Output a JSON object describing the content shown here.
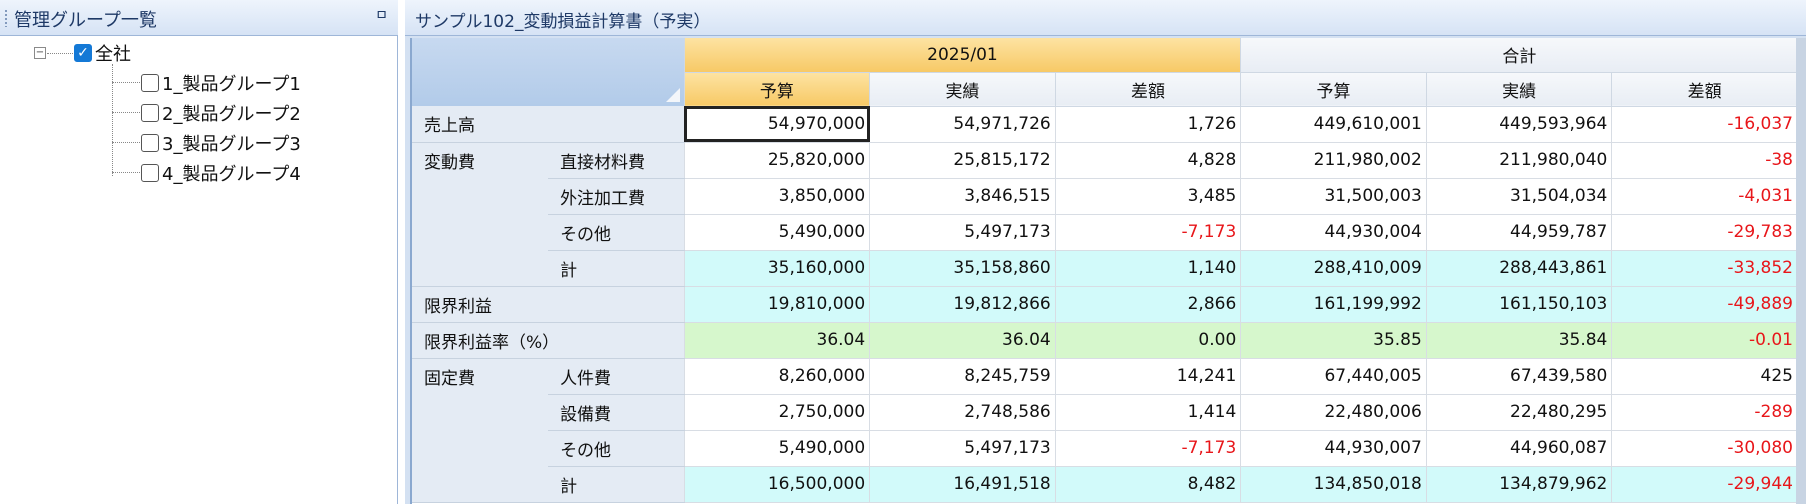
{
  "left_panel": {
    "title": "管理グループ一覧",
    "pin_glyph": "ㅁ",
    "expander_glyph": "−",
    "tree": {
      "root": {
        "label": "全社",
        "checked": true
      },
      "children": [
        {
          "label": "1_製品グループ1",
          "checked": false
        },
        {
          "label": "2_製品グループ2",
          "checked": false
        },
        {
          "label": "3_製品グループ3",
          "checked": false
        },
        {
          "label": "4_製品グループ4",
          "checked": false
        }
      ]
    }
  },
  "report": {
    "title": "サンプル102_変動損益計算書（予実）",
    "period_header": "2025/01",
    "total_header": "合計",
    "sub_headers": [
      "予算",
      "実績",
      "差額",
      "予算",
      "実績",
      "差額"
    ],
    "rows": [
      {
        "group": "売上高",
        "item": "",
        "type": "normal",
        "values": [
          "54,970,000",
          "54,971,726",
          "1,726",
          "449,610,001",
          "449,593,964",
          "-16,037"
        ]
      },
      {
        "group": "変動費",
        "item": "直接材料費",
        "type": "normal",
        "values": [
          "25,820,000",
          "25,815,172",
          "4,828",
          "211,980,002",
          "211,980,040",
          "-38"
        ]
      },
      {
        "group": "",
        "item": "外注加工費",
        "type": "normal",
        "values": [
          "3,850,000",
          "3,846,515",
          "3,485",
          "31,500,003",
          "31,504,034",
          "-4,031"
        ]
      },
      {
        "group": "",
        "item": "その他",
        "type": "normal",
        "values": [
          "5,490,000",
          "5,497,173",
          "-7,173",
          "44,930,004",
          "44,959,787",
          "-29,783"
        ]
      },
      {
        "group": "",
        "item": "計",
        "type": "sum",
        "values": [
          "35,160,000",
          "35,158,860",
          "1,140",
          "288,410,009",
          "288,443,861",
          "-33,852"
        ]
      },
      {
        "group": "限界利益",
        "item": "",
        "type": "sum",
        "values": [
          "19,810,000",
          "19,812,866",
          "2,866",
          "161,199,992",
          "161,150,103",
          "-49,889"
        ]
      },
      {
        "group": "限界利益率（%）",
        "item": "",
        "type": "rate",
        "values": [
          "36.04",
          "36.04",
          "0.00",
          "35.85",
          "35.84",
          "-0.01"
        ]
      },
      {
        "group": "固定費",
        "item": "人件費",
        "type": "normal",
        "values": [
          "8,260,000",
          "8,245,759",
          "14,241",
          "67,440,005",
          "67,439,580",
          "425"
        ]
      },
      {
        "group": "",
        "item": "設備費",
        "type": "normal",
        "values": [
          "2,750,000",
          "2,748,586",
          "1,414",
          "22,480,006",
          "22,480,295",
          "-289"
        ]
      },
      {
        "group": "",
        "item": "その他",
        "type": "normal",
        "values": [
          "5,490,000",
          "5,497,173",
          "-7,173",
          "44,930,007",
          "44,960,087",
          "-30,080"
        ]
      },
      {
        "group": "",
        "item": "計",
        "type": "sum",
        "values": [
          "16,500,000",
          "16,491,518",
          "8,482",
          "134,850,018",
          "134,879,962",
          "-29,944"
        ]
      }
    ]
  },
  "colors": {
    "negative": "#e8161a",
    "sum_row_bg": "#d2fafa",
    "rate_row_bg": "#d6f7cc",
    "period_header_bg": "#f7c966"
  }
}
